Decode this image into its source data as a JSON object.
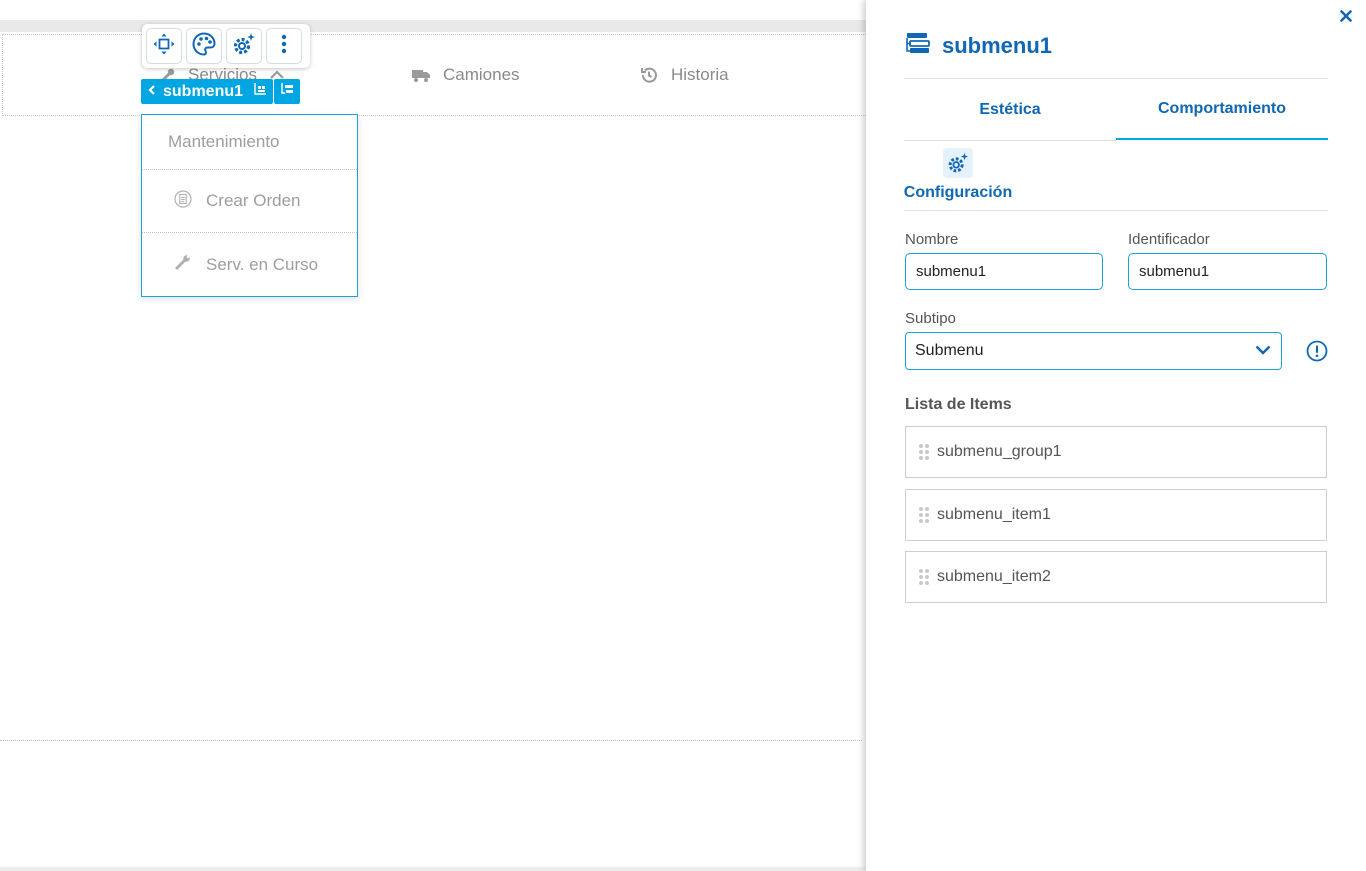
{
  "canvas": {
    "nav": {
      "servicios": "Servicios",
      "camiones": "Camiones",
      "historia": "Historia"
    },
    "selection_tag": {
      "label": "submenu1"
    },
    "submenu": {
      "group_label": "Mantenimiento",
      "items": [
        {
          "label": "Crear Orden",
          "icon": "document-icon"
        },
        {
          "label": "Serv. en Curso",
          "icon": "wrench-icon"
        }
      ]
    }
  },
  "panel": {
    "title": "submenu1",
    "tabs": [
      {
        "label": "Estética",
        "active": false
      },
      {
        "label": "Comportamiento",
        "active": true
      }
    ],
    "config_label": "Configuración",
    "fields": {
      "nombre": {
        "label": "Nombre",
        "value": "submenu1"
      },
      "identificador": {
        "label": "Identificador",
        "value": "submenu1"
      },
      "subtipo": {
        "label": "Subtipo",
        "value": "Submenu"
      }
    },
    "list_title": "Lista de Items",
    "list_items": [
      "submenu_group1",
      "submenu_item1",
      "submenu_item2"
    ]
  },
  "colors": {
    "accent": "#00a6e2",
    "brand_blue": "#1067b3",
    "muted_text": "#9e9e9e"
  }
}
